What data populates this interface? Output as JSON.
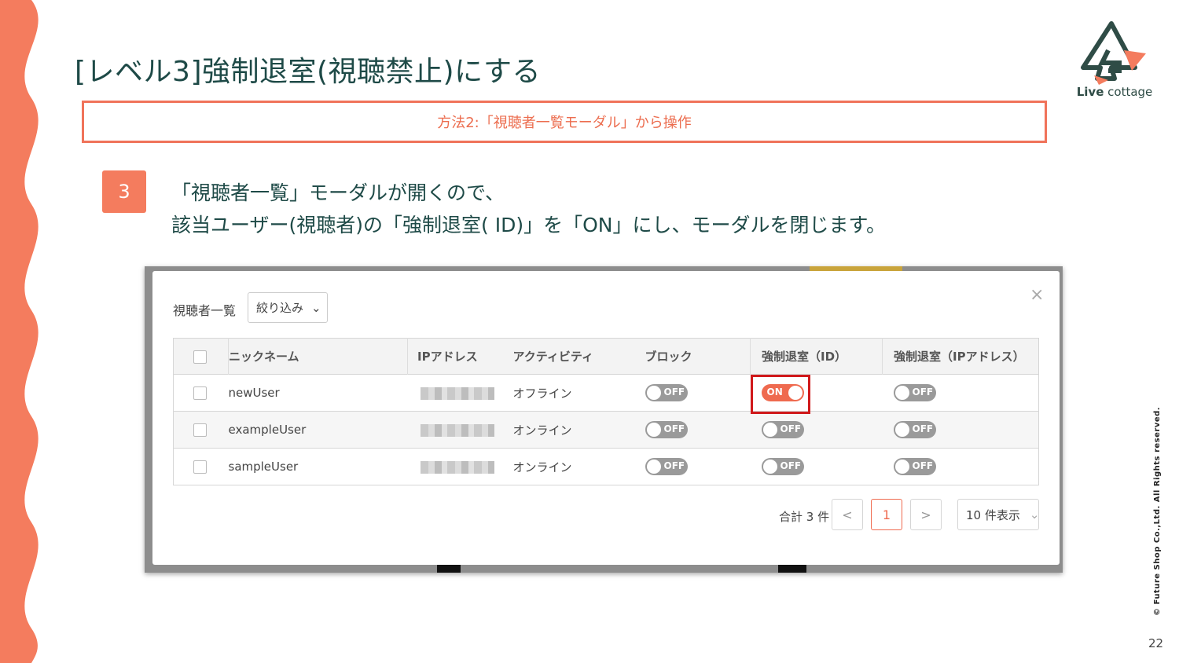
{
  "slide": {
    "title": "[レベル3]強制退室(視聴禁止)にする",
    "method": "方法2:「視聴者一覧モーダル」から操作",
    "step_number": "3",
    "instruction_line1": "「視聴者一覧」モーダルが開くので、",
    "instruction_line2": "該当ユーザー(視聴者)の「強制退室( ID)」を「ON」にし、モーダルを閉じます。",
    "logo_bold": "Live",
    "logo_rest": " cottage",
    "copyright": "© Future Shop Co.,Ltd. All Rights reserved.",
    "page_number": "22",
    "accent_color": "#f47c5e",
    "title_color": "#1e4a47"
  },
  "modal": {
    "title": "視聴者一覧",
    "filter_label": "絞り込み",
    "close_icon": "close-icon",
    "columns": [
      "ニックネーム",
      "IPアドレス",
      "アクティビティ",
      "ブロック",
      "強制退室（ID）",
      "強制退室（IPアドレス）"
    ],
    "rows": [
      {
        "nickname": "newUser",
        "activity": "オフライン",
        "block": "OFF",
        "kick_id": "ON",
        "kick_ip": "OFF"
      },
      {
        "nickname": "exampleUser",
        "activity": "オンライン",
        "block": "OFF",
        "kick_id": "OFF",
        "kick_ip": "OFF"
      },
      {
        "nickname": "sampleUser",
        "activity": "オンライン",
        "block": "OFF",
        "kick_id": "OFF",
        "kick_ip": "OFF"
      }
    ],
    "total": "合計 3 件",
    "current_page": "1",
    "prev": "<",
    "next": ">",
    "per_page": "10 件表示"
  }
}
